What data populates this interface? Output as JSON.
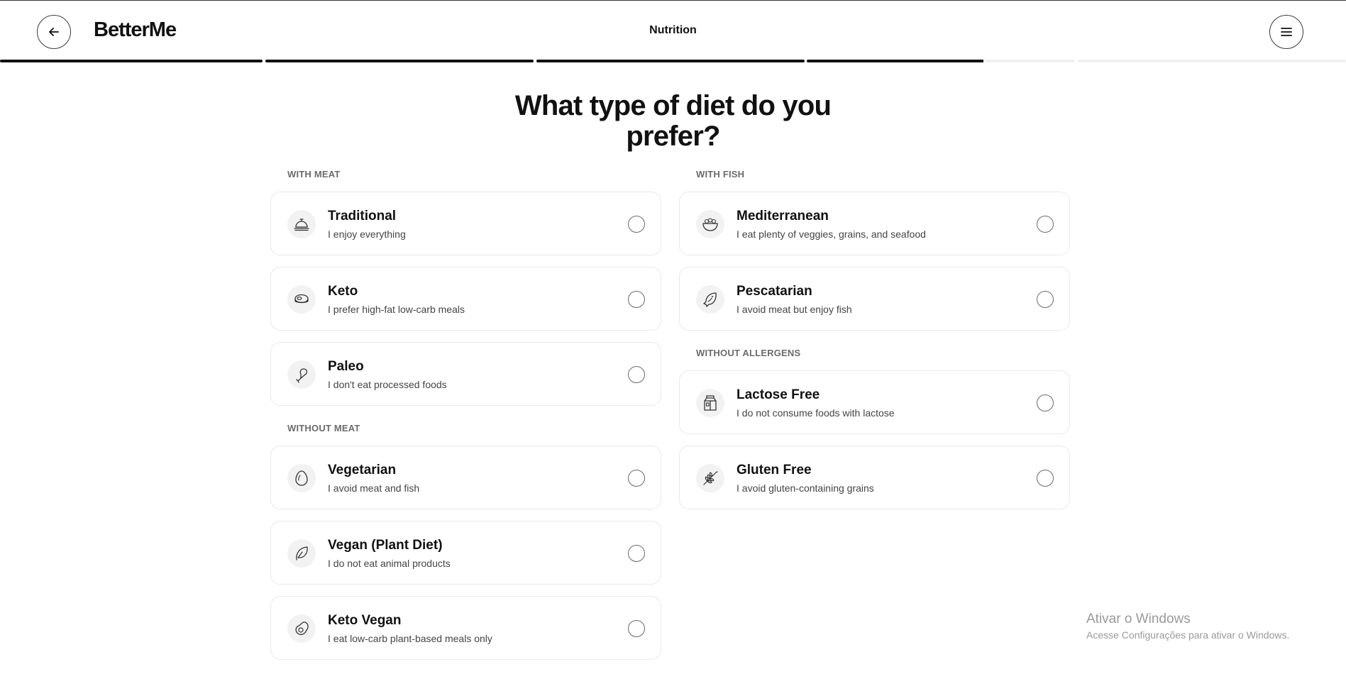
{
  "header": {
    "logo": "BetterMe",
    "title": "Nutrition",
    "back_icon": "arrow-left-icon",
    "menu_icon": "hamburger-menu-icon"
  },
  "progress": {
    "segments": [
      1,
      1,
      1,
      0.66,
      0,
      0
    ]
  },
  "question": {
    "line1": "What type of diet do you",
    "line2": "prefer?"
  },
  "sections": {
    "with_meat": "WITH MEAT",
    "without_meat": "WITHOUT MEAT",
    "with_fish": "WITH FISH",
    "without_allergens": "WITHOUT ALLERGENS"
  },
  "options": {
    "traditional": {
      "title": "Traditional",
      "sub": "I enjoy everything",
      "icon": "cloche-icon"
    },
    "keto": {
      "title": "Keto",
      "sub": "I prefer high-fat low-carb meals",
      "icon": "steak-icon"
    },
    "paleo": {
      "title": "Paleo",
      "sub": "I don't eat processed foods",
      "icon": "drumstick-icon"
    },
    "vegetarian": {
      "title": "Vegetarian",
      "sub": "I avoid meat and fish",
      "icon": "egg-icon"
    },
    "vegan": {
      "title": "Vegan (Plant Diet)",
      "sub": "I do not eat animal products",
      "icon": "leaf-icon"
    },
    "keto_vegan": {
      "title": "Keto Vegan",
      "sub": "I eat low-carb plant-based meals only",
      "icon": "avocado-icon"
    },
    "mediterranean": {
      "title": "Mediterranean",
      "sub": "I eat plenty of veggies, grains, and seafood",
      "icon": "salad-bowl-icon"
    },
    "pescatarian": {
      "title": "Pescatarian",
      "sub": "I avoid meat but enjoy fish",
      "icon": "fish-icon"
    },
    "lactose_free": {
      "title": "Lactose Free",
      "sub": "I do not consume foods with lactose",
      "icon": "milk-carton-icon"
    },
    "gluten_free": {
      "title": "Gluten Free",
      "sub": "I avoid gluten-containing grains",
      "icon": "wheat-icon"
    }
  },
  "watermark": {
    "line1": "Ativar o Windows",
    "line2": "Acesse Configurações para ativar o Windows."
  },
  "colors": {
    "accent": "#111111",
    "progress_track": "#f0f0f0",
    "card_border": "#e9e9e9",
    "icon_bg": "#f2f2f2"
  }
}
